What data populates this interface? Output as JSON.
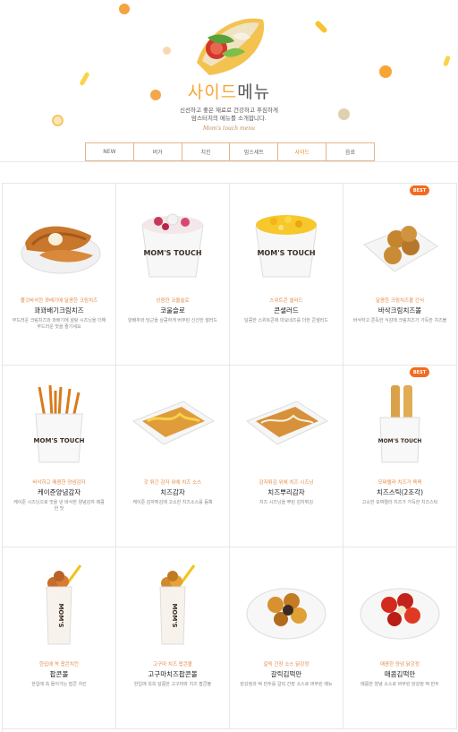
{
  "header": {
    "title_part1": "사이드",
    "title_part2": "메뉴",
    "desc_line1": "신선하고 좋은 재료로 건강하고 푸짐하게",
    "desc_line2": "맘스터치의 메뉴를 소개합니다.",
    "signature": "Mom's touch menu"
  },
  "tabs": [
    {
      "label": "NEW",
      "active": false
    },
    {
      "label": "버거",
      "active": false
    },
    {
      "label": "치킨",
      "active": false
    },
    {
      "label": "맘스세트",
      "active": false
    },
    {
      "label": "사이드",
      "active": true
    },
    {
      "label": "음료",
      "active": false
    }
  ],
  "items": [
    {
      "sub": "쫄깃바삭한 꽈배기에 달콤한 크림치즈",
      "name": "꽈꽈배기크림치즈",
      "info": "부드러운 크림치즈와 꽈배기에 설탕 시즈닝을 더해 부드러운 맛을 즐기세요",
      "badge": "",
      "icon": "twist-pastry-icon"
    },
    {
      "sub": "상큼한 코울슬로",
      "name": "코울슬로",
      "info": "양배추와 당근을 상큼하게 버무린 신선한 샐러드",
      "badge": "",
      "icon": "coleslaw-cup-icon"
    },
    {
      "sub": "스위트콘 샐러드",
      "name": "콘샐러드",
      "info": "달콤한 스위트콘에 마요네즈를 더한 콘샐러드",
      "badge": "",
      "icon": "corn-cup-icon"
    },
    {
      "sub": "달콤한 크림치즈볼 간식",
      "name": "바삭크림치즈볼",
      "info": "바삭하고 쫀득한 식감에 크림치즈가 가득한 치즈볼",
      "badge": "BEST",
      "icon": "cheese-ball-icon"
    },
    {
      "sub": "바삭하고 매콤한 양념감자",
      "name": "케이준양념감자",
      "info": "케이준 시즈닝으로 맛을 낸 바삭한 양념감자 매콤한 맛",
      "badge": "",
      "icon": "fries-bag-icon"
    },
    {
      "sub": "갓 튀긴 감자 위에 치즈 소스",
      "name": "치즈감자",
      "info": "케이준 감자튀김에 고소한 치즈소스를 듬뿍",
      "badge": "",
      "icon": "cheese-fries-icon"
    },
    {
      "sub": "감자튀김 위에 치즈 시즈닝",
      "name": "치즈뿌리감자",
      "info": "치즈 시즈닝을 뿌린 감자튀김",
      "badge": "",
      "icon": "seasoned-fries-icon"
    },
    {
      "sub": "모짜렐라 치즈가 쭉쭉",
      "name": "치즈스틱(2조각)",
      "info": "고소한 모짜렐라 치즈가 가득한 치즈스틱",
      "badge": "BEST",
      "icon": "cheese-stick-icon"
    },
    {
      "sub": "한입에 쏙 팝콘치킨",
      "name": "팝콘볼",
      "info": "한입에 쏙 들어가는 팝콘 치킨",
      "badge": "",
      "icon": "popcorn-cup-icon"
    },
    {
      "sub": "고구마 치즈 팝콘볼",
      "name": "고구마치즈팝콘볼",
      "info": "한입에 쏙쏙 달콤한 고구마와 치즈 팝콘볼",
      "badge": "",
      "icon": "sweetpotato-cup-icon"
    },
    {
      "sub": "갈릭 간장 소스 닭강정",
      "name": "갈릭김떡만",
      "info": "닭강정과 떡 만두를 갈릭 간장 소스로 버무린 메뉴",
      "badge": "",
      "icon": "garlic-chicken-icon"
    },
    {
      "sub": "매콤한 양념 닭강정",
      "name": "매콤김떡만",
      "info": "매콤한 양념 소스로 버무린 닭강정 떡 만두",
      "badge": "",
      "icon": "spicy-chicken-icon"
    }
  ]
}
